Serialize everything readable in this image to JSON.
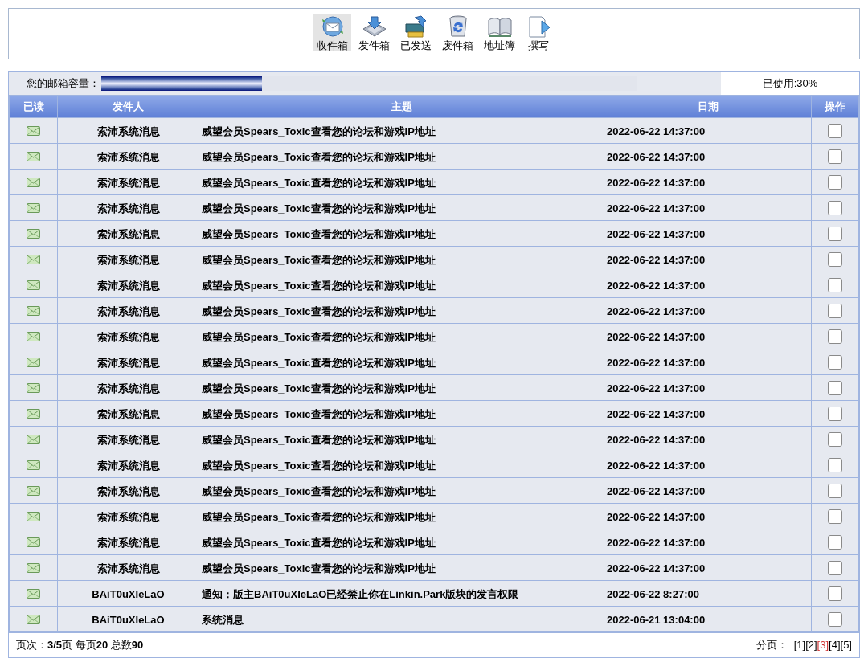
{
  "toolbar": {
    "items": [
      {
        "label": "收件箱",
        "selected": true
      },
      {
        "label": "发件箱",
        "selected": false
      },
      {
        "label": "已发送",
        "selected": false
      },
      {
        "label": "废件箱",
        "selected": false
      },
      {
        "label": "地址簿",
        "selected": false
      },
      {
        "label": "撰写",
        "selected": false
      }
    ]
  },
  "capacity": {
    "label": "您的邮箱容量：",
    "level": 0.3,
    "usage": "已使用:30%"
  },
  "table": {
    "columns": [
      "已读",
      "发件人",
      "主题",
      "日期",
      "操作"
    ],
    "rows": [
      {
        "sender": "索沛系统消息",
        "subject": "威望会员Spears_Toxic查看您的论坛和游戏IP地址",
        "date": "2022-06-22 14:37:00",
        "checked": false
      },
      {
        "sender": "索沛系统消息",
        "subject": "威望会员Spears_Toxic查看您的论坛和游戏IP地址",
        "date": "2022-06-22 14:37:00",
        "checked": false
      },
      {
        "sender": "索沛系统消息",
        "subject": "威望会员Spears_Toxic查看您的论坛和游戏IP地址",
        "date": "2022-06-22 14:37:00",
        "checked": false
      },
      {
        "sender": "索沛系统消息",
        "subject": "威望会员Spears_Toxic查看您的论坛和游戏IP地址",
        "date": "2022-06-22 14:37:00",
        "checked": false
      },
      {
        "sender": "索沛系统消息",
        "subject": "威望会员Spears_Toxic查看您的论坛和游戏IP地址",
        "date": "2022-06-22 14:37:00",
        "checked": false
      },
      {
        "sender": "索沛系统消息",
        "subject": "威望会员Spears_Toxic查看您的论坛和游戏IP地址",
        "date": "2022-06-22 14:37:00",
        "checked": false
      },
      {
        "sender": "索沛系统消息",
        "subject": "威望会员Spears_Toxic查看您的论坛和游戏IP地址",
        "date": "2022-06-22 14:37:00",
        "checked": false
      },
      {
        "sender": "索沛系统消息",
        "subject": "威望会员Spears_Toxic查看您的论坛和游戏IP地址",
        "date": "2022-06-22 14:37:00",
        "checked": false
      },
      {
        "sender": "索沛系统消息",
        "subject": "威望会员Spears_Toxic查看您的论坛和游戏IP地址",
        "date": "2022-06-22 14:37:00",
        "checked": false
      },
      {
        "sender": "索沛系统消息",
        "subject": "威望会员Spears_Toxic查看您的论坛和游戏IP地址",
        "date": "2022-06-22 14:37:00",
        "checked": false
      },
      {
        "sender": "索沛系统消息",
        "subject": "威望会员Spears_Toxic查看您的论坛和游戏IP地址",
        "date": "2022-06-22 14:37:00",
        "checked": false
      },
      {
        "sender": "索沛系统消息",
        "subject": "威望会员Spears_Toxic查看您的论坛和游戏IP地址",
        "date": "2022-06-22 14:37:00",
        "checked": false
      },
      {
        "sender": "索沛系统消息",
        "subject": "威望会员Spears_Toxic查看您的论坛和游戏IP地址",
        "date": "2022-06-22 14:37:00",
        "checked": false
      },
      {
        "sender": "索沛系统消息",
        "subject": "威望会员Spears_Toxic查看您的论坛和游戏IP地址",
        "date": "2022-06-22 14:37:00",
        "checked": false
      },
      {
        "sender": "索沛系统消息",
        "subject": "威望会员Spears_Toxic查看您的论坛和游戏IP地址",
        "date": "2022-06-22 14:37:00",
        "checked": false
      },
      {
        "sender": "索沛系统消息",
        "subject": "威望会员Spears_Toxic查看您的论坛和游戏IP地址",
        "date": "2022-06-22 14:37:00",
        "checked": false
      },
      {
        "sender": "索沛系统消息",
        "subject": "威望会员Spears_Toxic查看您的论坛和游戏IP地址",
        "date": "2022-06-22 14:37:00",
        "checked": false
      },
      {
        "sender": "索沛系统消息",
        "subject": "威望会员Spears_Toxic查看您的论坛和游戏IP地址",
        "date": "2022-06-22 14:37:00",
        "checked": false
      },
      {
        "sender": "BAiT0uXIeLaO",
        "subject": "通知：版主BAiT0uXIeLaO已经禁止你在Linkin.Park版块的发言权限",
        "date": "2022-06-22 8:27:00",
        "checked": false
      },
      {
        "sender": "BAiT0uXIeLaO",
        "subject": "系统消息",
        "date": "2022-06-21 13:04:00",
        "checked": false
      }
    ]
  },
  "footer": {
    "summary": "页次：**3/5**页 每页**20** 总数**90**",
    "pagination": {
      "label": "分页：",
      "pages": [
        {
          "label": "[1]",
          "selected": false
        },
        {
          "label": "[2]",
          "selected": false
        },
        {
          "label": "[3]",
          "selected": true
        },
        {
          "label": "[4]",
          "selected": false
        },
        {
          "label": "[5]",
          "selected": false
        }
      ]
    }
  }
}
